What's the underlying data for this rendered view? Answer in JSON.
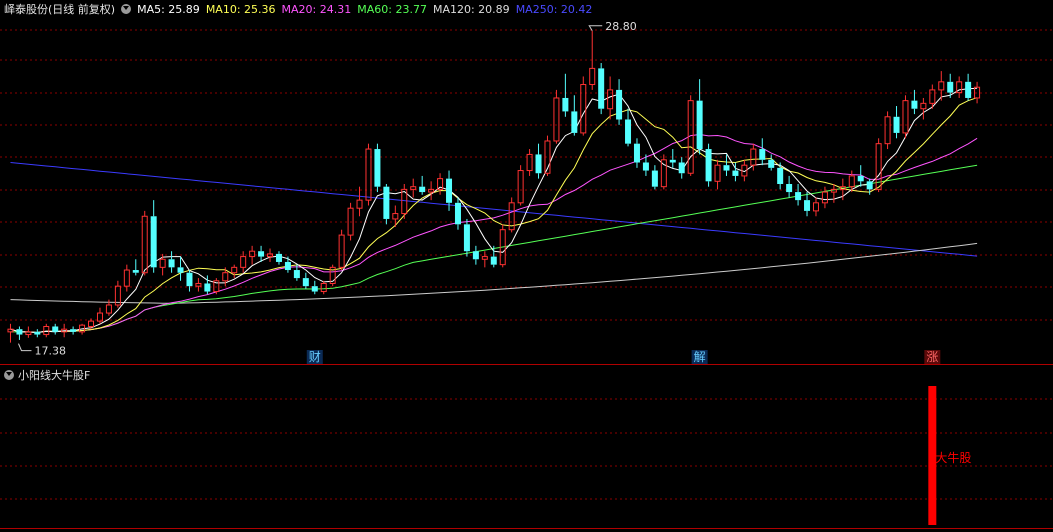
{
  "main_panel": {
    "stock_name": "峄泰股份(日线 前复权)",
    "ma_labels": [
      {
        "text": "MA5: 25.89",
        "color": "#ffffff"
      },
      {
        "text": "MA10: 25.36",
        "color": "#ffff55"
      },
      {
        "text": "MA20: 24.31",
        "color": "#ff55ff"
      },
      {
        "text": "MA60: 23.77",
        "color": "#55ff55"
      },
      {
        "text": "MA120: 20.89",
        "color": "#dddddd"
      },
      {
        "text": "MA250: 20.42",
        "color": "#5555ff"
      }
    ],
    "high_label": "28.80",
    "low_label": "17.38",
    "event_markers": [
      {
        "text": "财",
        "index": 34
      },
      {
        "text": "解",
        "index": 77
      },
      {
        "text": "涨",
        "index": 103
      }
    ]
  },
  "sub_panel": {
    "indicator_name": "小阳线大牛股F",
    "signal_label": "大牛股",
    "signal_color": "#ff0000"
  },
  "colors": {
    "up": "#ff3232",
    "down": "#54ffff",
    "ma5": "#ffffff",
    "ma10": "#ffff55",
    "ma20": "#ff55ff",
    "ma60": "#55ff55",
    "ma120": "#cccccc",
    "ma250": "#3b3bff",
    "grid": "#8b0000"
  },
  "chart_data": {
    "type": "candlestick",
    "ylim": [
      17.0,
      29.2
    ],
    "candles": [
      [
        17.6,
        17.9,
        17.2,
        17.7
      ],
      [
        17.7,
        17.8,
        17.3,
        17.5
      ],
      [
        17.5,
        17.8,
        17.38,
        17.6
      ],
      [
        17.6,
        17.7,
        17.4,
        17.5
      ],
      [
        17.5,
        17.9,
        17.4,
        17.8
      ],
      [
        17.8,
        17.9,
        17.5,
        17.6
      ],
      [
        17.6,
        17.9,
        17.4,
        17.7
      ],
      [
        17.7,
        17.8,
        17.5,
        17.6
      ],
      [
        17.6,
        17.9,
        17.5,
        17.85
      ],
      [
        17.8,
        18.1,
        17.7,
        18.0
      ],
      [
        18.0,
        18.5,
        17.9,
        18.3
      ],
      [
        18.3,
        18.8,
        18.2,
        18.6
      ],
      [
        18.6,
        19.5,
        18.5,
        19.3
      ],
      [
        19.3,
        20.1,
        19.1,
        19.9
      ],
      [
        19.9,
        20.3,
        19.7,
        19.8
      ],
      [
        19.8,
        22.1,
        19.7,
        21.9
      ],
      [
        21.9,
        22.5,
        19.8,
        20.0
      ],
      [
        20.0,
        20.5,
        19.7,
        20.3
      ],
      [
        20.3,
        20.6,
        19.8,
        20.0
      ],
      [
        20.0,
        20.4,
        19.5,
        19.8
      ],
      [
        19.8,
        19.9,
        19.1,
        19.3
      ],
      [
        19.3,
        19.6,
        19.1,
        19.4
      ],
      [
        19.4,
        19.7,
        19.0,
        19.1
      ],
      [
        19.1,
        19.6,
        19.0,
        19.5
      ],
      [
        19.5,
        20.0,
        19.3,
        19.8
      ],
      [
        19.8,
        20.1,
        19.6,
        20.0
      ],
      [
        20.0,
        20.6,
        19.8,
        20.4
      ],
      [
        20.4,
        20.8,
        20.1,
        20.6
      ],
      [
        20.6,
        20.8,
        20.2,
        20.4
      ],
      [
        20.4,
        20.7,
        20.2,
        20.5
      ],
      [
        20.5,
        20.6,
        20.1,
        20.2
      ],
      [
        20.2,
        20.4,
        19.8,
        19.9
      ],
      [
        19.9,
        20.1,
        19.5,
        19.6
      ],
      [
        19.6,
        19.8,
        19.2,
        19.3
      ],
      [
        19.3,
        19.5,
        19.0,
        19.1
      ],
      [
        19.1,
        19.5,
        19.0,
        19.4
      ],
      [
        19.4,
        20.1,
        19.3,
        20.0
      ],
      [
        20.0,
        21.4,
        19.9,
        21.2
      ],
      [
        21.2,
        22.4,
        21.0,
        22.2
      ],
      [
        22.2,
        23.0,
        21.9,
        22.5
      ],
      [
        22.5,
        24.6,
        22.3,
        24.4
      ],
      [
        24.4,
        24.6,
        22.8,
        23.0
      ],
      [
        23.0,
        23.1,
        21.6,
        21.8
      ],
      [
        21.8,
        22.3,
        21.5,
        22.0
      ],
      [
        22.0,
        23.1,
        21.8,
        22.9
      ],
      [
        22.9,
        23.3,
        22.6,
        23.0
      ],
      [
        23.0,
        23.4,
        22.7,
        22.8
      ],
      [
        22.8,
        23.2,
        22.5,
        22.9
      ],
      [
        22.9,
        23.5,
        22.7,
        23.3
      ],
      [
        23.3,
        23.6,
        22.1,
        22.4
      ],
      [
        22.4,
        22.6,
        21.4,
        21.6
      ],
      [
        21.6,
        21.8,
        20.4,
        20.6
      ],
      [
        20.6,
        20.8,
        20.1,
        20.3
      ],
      [
        20.3,
        20.6,
        20.0,
        20.4
      ],
      [
        20.4,
        20.8,
        20.0,
        20.1
      ],
      [
        20.1,
        21.6,
        20.0,
        21.4
      ],
      [
        21.4,
        22.6,
        21.3,
        22.4
      ],
      [
        22.4,
        23.8,
        22.3,
        23.6
      ],
      [
        23.6,
        24.4,
        23.4,
        24.2
      ],
      [
        24.2,
        24.6,
        23.3,
        23.5
      ],
      [
        23.5,
        24.9,
        23.4,
        24.7
      ],
      [
        24.7,
        26.6,
        24.6,
        26.3
      ],
      [
        26.3,
        27.2,
        25.6,
        25.8
      ],
      [
        25.8,
        26.4,
        24.9,
        25.0
      ],
      [
        25.0,
        27.1,
        24.9,
        26.8
      ],
      [
        26.8,
        28.8,
        26.6,
        27.4
      ],
      [
        27.4,
        27.6,
        25.7,
        25.9
      ],
      [
        25.9,
        27.1,
        25.5,
        26.6
      ],
      [
        26.6,
        27.0,
        25.3,
        25.5
      ],
      [
        25.5,
        25.9,
        24.5,
        24.6
      ],
      [
        24.6,
        24.8,
        23.7,
        23.9
      ],
      [
        23.9,
        24.2,
        23.4,
        23.6
      ],
      [
        23.6,
        23.8,
        22.9,
        23.0
      ],
      [
        23.0,
        24.2,
        22.9,
        24.0
      ],
      [
        24.0,
        24.4,
        23.7,
        23.9
      ],
      [
        23.9,
        24.1,
        23.3,
        23.5
      ],
      [
        23.5,
        26.4,
        23.4,
        26.2
      ],
      [
        26.2,
        27.0,
        24.2,
        24.4
      ],
      [
        24.4,
        24.6,
        23.0,
        23.2
      ],
      [
        23.2,
        24.0,
        22.9,
        23.8
      ],
      [
        23.8,
        24.2,
        23.4,
        23.6
      ],
      [
        23.6,
        23.9,
        23.2,
        23.4
      ],
      [
        23.4,
        24.0,
        23.2,
        23.8
      ],
      [
        23.8,
        24.6,
        23.6,
        24.4
      ],
      [
        24.4,
        24.8,
        23.8,
        24.0
      ],
      [
        24.0,
        24.2,
        23.6,
        23.7
      ],
      [
        23.7,
        23.9,
        22.9,
        23.1
      ],
      [
        23.1,
        23.4,
        22.6,
        22.8
      ],
      [
        22.8,
        23.1,
        22.3,
        22.5
      ],
      [
        22.5,
        22.8,
        21.9,
        22.1
      ],
      [
        22.1,
        22.6,
        21.9,
        22.4
      ],
      [
        22.4,
        23.0,
        22.2,
        22.8
      ],
      [
        22.8,
        23.1,
        22.4,
        22.9
      ],
      [
        22.9,
        23.3,
        22.5,
        23.0
      ],
      [
        23.0,
        23.6,
        22.8,
        23.4
      ],
      [
        23.4,
        23.8,
        23.0,
        23.2
      ],
      [
        23.2,
        23.3,
        22.7,
        22.9
      ],
      [
        22.9,
        24.8,
        22.8,
        24.6
      ],
      [
        24.6,
        25.8,
        24.4,
        25.6
      ],
      [
        25.6,
        26.0,
        24.8,
        25.0
      ],
      [
        25.0,
        26.4,
        24.8,
        26.2
      ],
      [
        26.2,
        26.6,
        25.7,
        25.9
      ],
      [
        25.9,
        26.3,
        25.5,
        26.1
      ],
      [
        26.1,
        26.8,
        25.9,
        26.6
      ],
      [
        26.6,
        27.3,
        26.2,
        26.9
      ],
      [
        26.9,
        27.2,
        26.3,
        26.5
      ],
      [
        26.5,
        27.1,
        26.3,
        26.9
      ],
      [
        26.9,
        27.2,
        26.2,
        26.3
      ],
      [
        26.3,
        26.9,
        26.1,
        26.7
      ]
    ],
    "signal_index": 103
  }
}
